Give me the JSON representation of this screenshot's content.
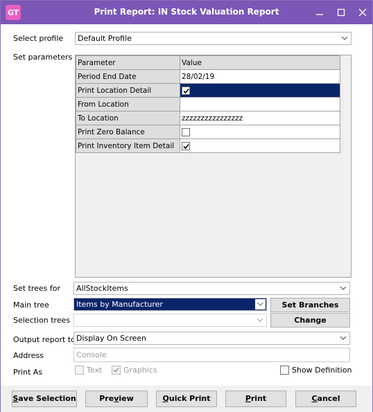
{
  "window": {
    "logo_text": "GT",
    "title": "Print Report: IN Stock Valuation Report"
  },
  "profile": {
    "label": "Select profile",
    "value": "Default Profile"
  },
  "parameters": {
    "label": "Set parameters",
    "header": {
      "name": "Parameter",
      "value": "Value"
    },
    "rows": [
      {
        "name": "Period End Date",
        "value": "28/02/19"
      },
      {
        "name": "Print Location Detail",
        "checked": true
      },
      {
        "name": "From Location",
        "value": ""
      },
      {
        "name": "To Location",
        "value": "zzzzzzzzzzzzzzzz"
      },
      {
        "name": "Print Zero Balance",
        "checked": false
      },
      {
        "name": "Print Inventory Item Detail",
        "checked": true
      }
    ]
  },
  "trees": {
    "set_trees_label": "Set trees for",
    "set_trees_value": "AllStockItems",
    "main_tree_label": "Main tree",
    "main_tree_value": "Items by Manufacturer",
    "selection_trees_label": "Selection trees",
    "selection_trees_value": "",
    "set_branches_button": "Set Branches",
    "change_button": "Change"
  },
  "output": {
    "label": "Output report to",
    "value": "Display On Screen",
    "address_label": "Address",
    "address_value": "Console",
    "print_as_label": "Print As",
    "text_option": "Text",
    "text_checked": false,
    "graphics_option": "Graphics",
    "graphics_checked": true,
    "show_definition": "Show Definition",
    "show_definition_checked": false
  },
  "buttons": {
    "save_selection_pre": "S",
    "save_selection_rest": "ave Selection",
    "preview_pre": "Pre",
    "preview_u": "v",
    "preview_rest": "iew",
    "quick_print_pre": "Q",
    "quick_print_rest": "uick Print",
    "print_pre": "P",
    "print_rest": "rint",
    "cancel_pre": "C",
    "cancel_rest": "ancel"
  },
  "colors": {
    "titlebar": "#7b57b8",
    "logo": "#e95ec1",
    "selection": "#0a246a"
  }
}
